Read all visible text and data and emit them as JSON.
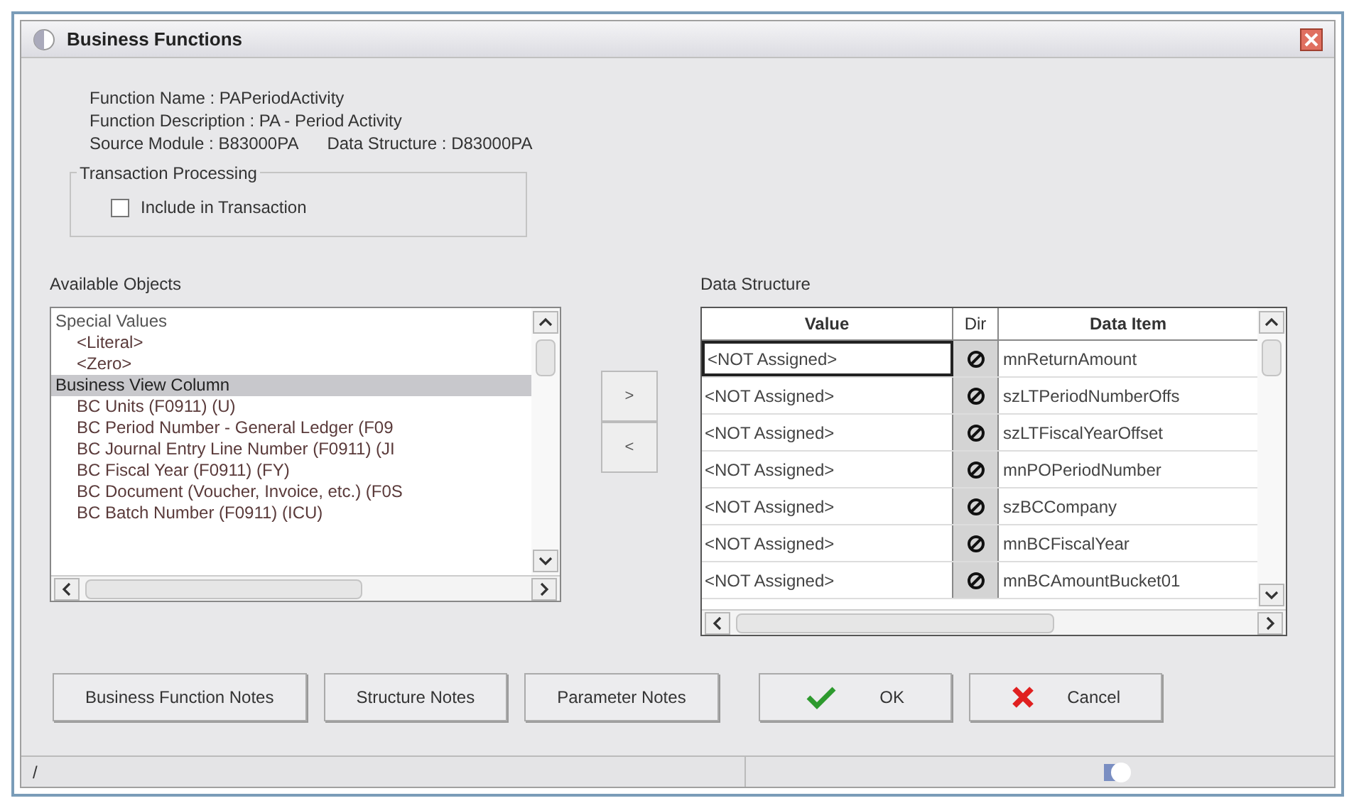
{
  "window": {
    "title": "Business Functions"
  },
  "info": {
    "function_name": "Function Name : PAPeriodActivity",
    "function_description": "Function Description : PA - Period Activity",
    "source_module": "Source Module : B83000PA",
    "data_structure": "Data Structure : D83000PA"
  },
  "transaction_processing": {
    "title": "Transaction Processing",
    "checkbox": {
      "label": "Include in Transaction",
      "checked": false
    }
  },
  "available_objects": {
    "label": "Available Objects",
    "items": [
      {
        "label": "Special Values",
        "selected": false,
        "children": [
          {
            "label": "<Literal>",
            "selected": false
          },
          {
            "label": "<Zero>",
            "selected": false
          }
        ]
      },
      {
        "label": "Business View Column",
        "selected": true,
        "children": [
          {
            "label": "BC Units (F0911) (U)",
            "selected": false
          },
          {
            "label": "BC Period Number - General Ledger (F09",
            "selected": false
          },
          {
            "label": "BC Journal Entry Line Number (F0911) (JI",
            "selected": false
          },
          {
            "label": "BC Fiscal Year (F0911) (FY)",
            "selected": false
          },
          {
            "label": "BC Document (Voucher, Invoice, etc.) (F0S",
            "selected": false
          },
          {
            "label": "BC Batch Number (F0911) (ICU)",
            "selected": false
          }
        ]
      }
    ]
  },
  "move_buttons": [
    ">",
    "<"
  ],
  "data_structure": {
    "label": "Data Structure",
    "columns": [
      "Value",
      "Dir",
      "Data Item"
    ],
    "rows": [
      {
        "value": "<NOT Assigned>",
        "data_item": "mnReturnAmount",
        "focused": true
      },
      {
        "value": "<NOT Assigned>",
        "data_item": "szLTPeriodNumberOffs",
        "focused": false
      },
      {
        "value": "<NOT Assigned>",
        "data_item": "szLTFiscalYearOffset",
        "focused": false
      },
      {
        "value": "<NOT Assigned>",
        "data_item": "mnPOPeriodNumber",
        "focused": false
      },
      {
        "value": "<NOT Assigned>",
        "data_item": "szBCCompany",
        "focused": false
      },
      {
        "value": "<NOT Assigned>",
        "data_item": "mnBCFiscalYear",
        "focused": false
      },
      {
        "value": "<NOT Assigned>",
        "data_item": "mnBCAmountBucket01",
        "focused": false
      }
    ]
  },
  "buttons": [
    {
      "label": "Business Function Notes",
      "kind": "plain"
    },
    {
      "label": "Structure Notes",
      "kind": "plain"
    },
    {
      "label": "Parameter Notes",
      "kind": "plain"
    },
    {
      "label": "OK",
      "kind": "ok"
    },
    {
      "label": "Cancel",
      "kind": "cancel"
    }
  ],
  "status_bar": {
    "text": "/"
  }
}
